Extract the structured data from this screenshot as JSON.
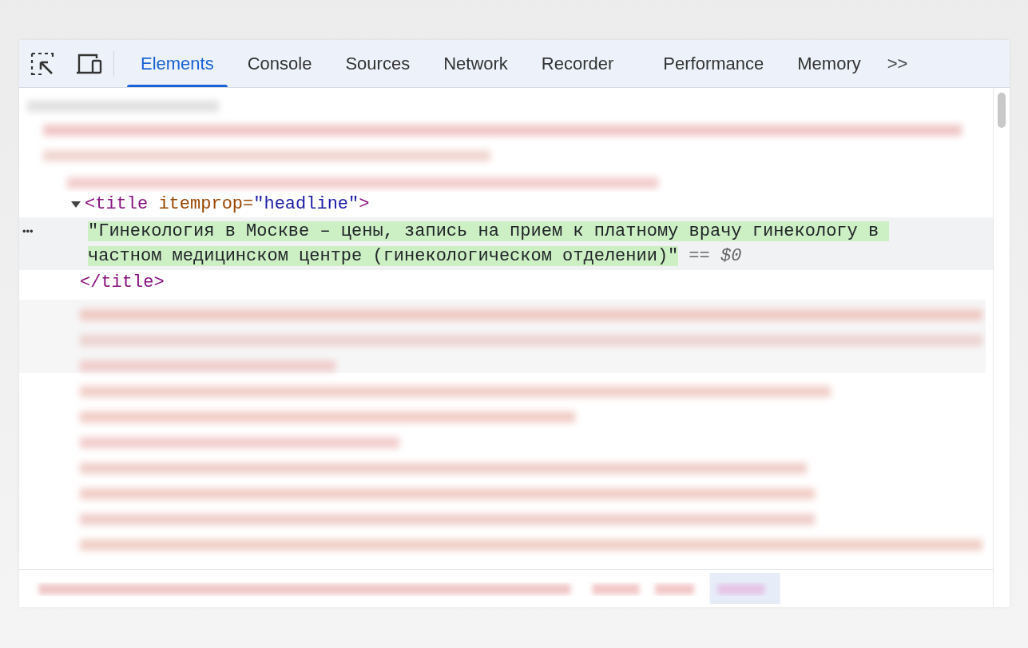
{
  "tabs": [
    {
      "label": "Elements",
      "selected": true
    },
    {
      "label": "Console",
      "selected": false
    },
    {
      "label": "Sources",
      "selected": false
    },
    {
      "label": "Network",
      "selected": false
    },
    {
      "label": "Recorder",
      "selected": false
    },
    {
      "label": "Performance",
      "selected": false
    },
    {
      "label": "Memory",
      "selected": false
    }
  ],
  "more_tabs": ">>",
  "open_tag": {
    "expanded": true,
    "tag": "<title",
    "attr": " itemprop=",
    "value": "\"headline\"",
    "end": ">"
  },
  "text_node": {
    "row_menu": "•••",
    "text": "\"Гинекология в Москве – цены, запись на прием к платному врачу гинекологу в частном медицинском центре (гинекологическом отделении)\"",
    "selected": true,
    "equals": "==",
    "ref": "$0"
  },
  "close_tag": {
    "tag": "</title>"
  }
}
